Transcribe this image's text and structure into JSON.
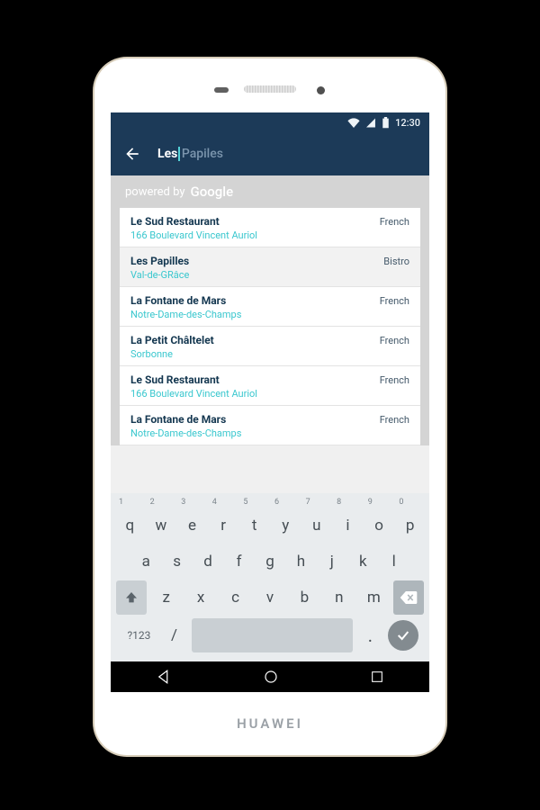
{
  "statusbar": {
    "time": "12:30"
  },
  "search": {
    "typed": "Les",
    "placeholder_suffix": "Papiles"
  },
  "poweredby": {
    "prefix": "powered by",
    "brand": "Google"
  },
  "results": [
    {
      "name": "Le Sud Restaurant",
      "tag": "French",
      "sub": "166 Boulevard Vincent Auriol",
      "selected": false
    },
    {
      "name": "Les Papilles",
      "tag": "Bistro",
      "sub": "Val-de-GRâce",
      "selected": true
    },
    {
      "name": "La Fontane de Mars",
      "tag": "French",
      "sub": "Notre-Dame-des-Champs",
      "selected": false
    },
    {
      "name": "La Petit Châltelet",
      "tag": "French",
      "sub": "Sorbonne",
      "selected": false
    },
    {
      "name": "Le Sud Restaurant",
      "tag": "French",
      "sub": "166 Boulevard Vincent Auriol",
      "selected": false
    },
    {
      "name": "La Fontane de Mars",
      "tag": "French",
      "sub": "Notre-Dame-des-Champs",
      "selected": false
    }
  ],
  "keyboard": {
    "digits": [
      "1",
      "2",
      "3",
      "4",
      "5",
      "6",
      "7",
      "8",
      "9",
      "0"
    ],
    "row1": [
      "q",
      "w",
      "e",
      "r",
      "t",
      "y",
      "u",
      "i",
      "o",
      "p"
    ],
    "row2": [
      "a",
      "s",
      "d",
      "f",
      "g",
      "h",
      "j",
      "k",
      "l"
    ],
    "row3": [
      "z",
      "x",
      "c",
      "v",
      "b",
      "n",
      "m"
    ],
    "sym": "?123",
    "slash": "/",
    "dot": "."
  },
  "device": {
    "brand": "HUAWEI"
  }
}
